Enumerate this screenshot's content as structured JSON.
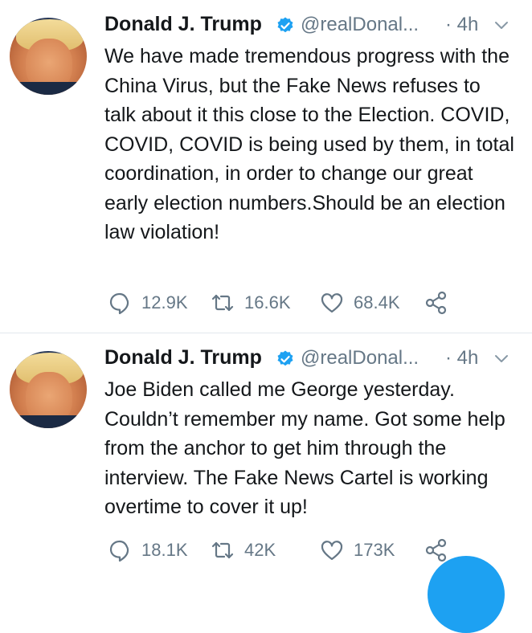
{
  "tweets": [
    {
      "name": "Donald J. Trump",
      "handle": "@realDonal...",
      "time": "· 4h",
      "text": "We have made tremendous progress with the China Virus, but the Fake News refuses to talk about it this close to the Election. COVID, COVID, COVID is being used by them, in total coordination, in order to change our great early election numbers.Should be an election law violation!",
      "replies": "12.9K",
      "retweets": "16.6K",
      "likes": "68.4K"
    },
    {
      "name": "Donald J. Trump",
      "handle": "@realDonal...",
      "time": "· 4h",
      "text": "Joe Biden called me George yesterday. Couldn’t remember my name. Got some help from the anchor to get him through the interview. The Fake News Cartel is working overtime to cover it up!",
      "replies": "18.1K",
      "retweets": "42K",
      "likes": "173K"
    }
  ],
  "icons": {
    "verified": "verified-badge-icon",
    "caret": "chevron-down-icon",
    "reply": "reply-icon",
    "retweet": "retweet-icon",
    "like": "heart-icon",
    "share": "share-icon"
  },
  "colors": {
    "accent": "#1da1f2",
    "text": "#14171a",
    "secondary": "#657786",
    "divider": "#e1e8ed"
  }
}
